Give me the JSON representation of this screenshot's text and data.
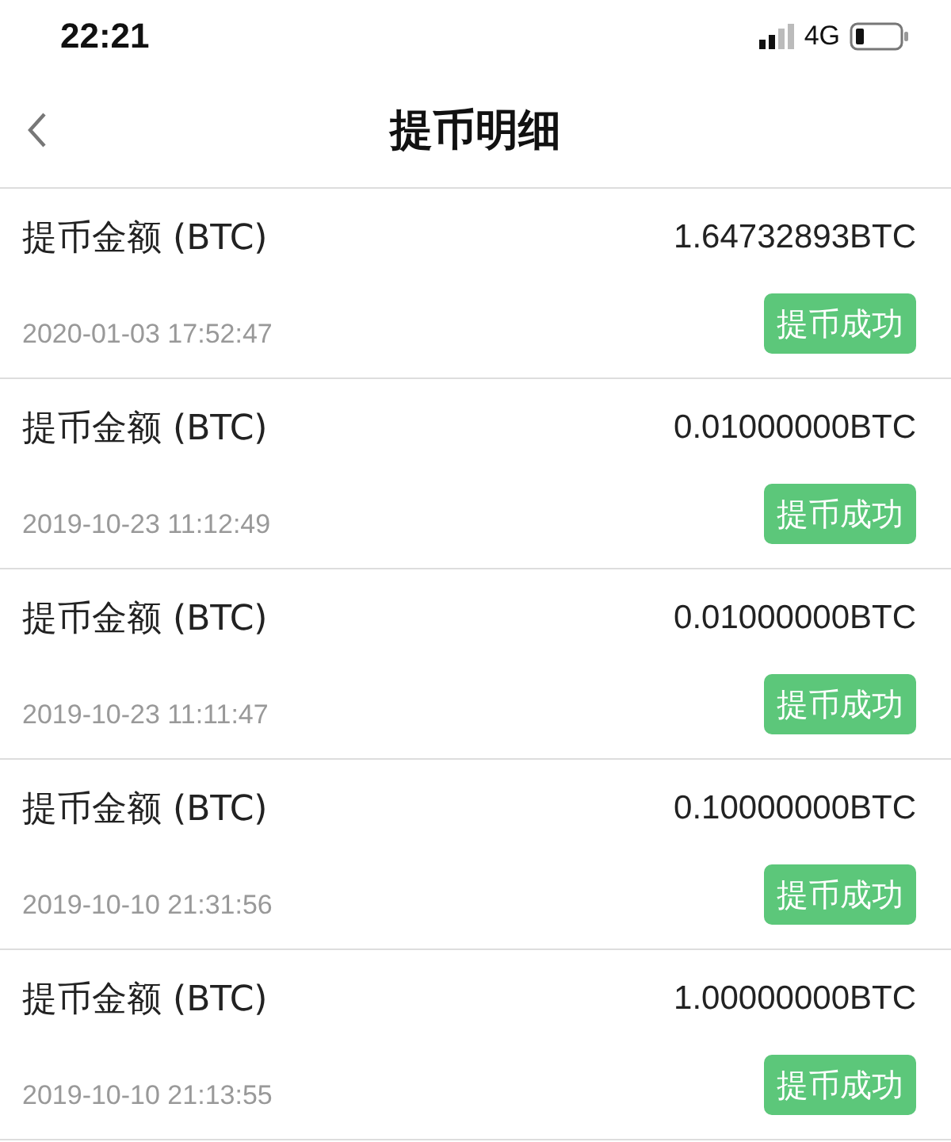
{
  "status_bar": {
    "time": "22:21",
    "network": "4G"
  },
  "nav": {
    "title": "提币明细"
  },
  "records": [
    {
      "label": "提币金额 (BTC)",
      "amount": "1.64732893BTC",
      "time": "2020-01-03 17:52:47",
      "status": "提币成功"
    },
    {
      "label": "提币金额 (BTC)",
      "amount": "0.01000000BTC",
      "time": "2019-10-23 11:12:49",
      "status": "提币成功"
    },
    {
      "label": "提币金额 (BTC)",
      "amount": "0.01000000BTC",
      "time": "2019-10-23 11:11:47",
      "status": "提币成功"
    },
    {
      "label": "提币金额 (BTC)",
      "amount": "0.10000000BTC",
      "time": "2019-10-10 21:31:56",
      "status": "提币成功"
    },
    {
      "label": "提币金额 (BTC)",
      "amount": "1.00000000BTC",
      "time": "2019-10-10 21:13:55",
      "status": "提币成功"
    }
  ]
}
